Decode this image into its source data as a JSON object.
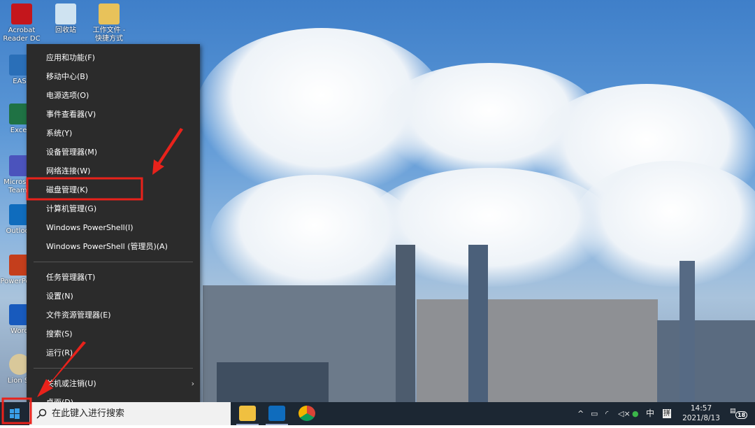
{
  "desktop": {
    "icons": [
      {
        "label": "Acrobat Reader DC",
        "color": "#c4161c"
      },
      {
        "label": "回收站",
        "color": "#cfe3f1"
      },
      {
        "label": "工作文件 - 快捷方式",
        "color": "#e8c25a"
      },
      {
        "label": "EAS",
        "color": "#2a6fb8"
      },
      {
        "label": "Excel",
        "color": "#1f7244"
      },
      {
        "label": "Microsoft Teams",
        "color": "#4b53bc"
      },
      {
        "label": "Outlook",
        "color": "#0f6cbd"
      },
      {
        "label": "PowerPoint",
        "color": "#c43e1c"
      },
      {
        "label": "Word",
        "color": "#185abd"
      },
      {
        "label": "Lion St",
        "color": "#d9c89a"
      }
    ]
  },
  "context_menu": {
    "groups": [
      [
        "应用和功能(F)",
        "移动中心(B)",
        "电源选项(O)",
        "事件查看器(V)",
        "系统(Y)",
        "设备管理器(M)",
        "网络连接(W)",
        "磁盘管理(K)",
        "计算机管理(G)",
        "Windows PowerShell(I)",
        "Windows PowerShell (管理员)(A)"
      ],
      [
        "任务管理器(T)",
        "设置(N)",
        "文件资源管理器(E)",
        "搜索(S)",
        "运行(R)"
      ],
      [
        "关机或注销(U)",
        "桌面(D)"
      ]
    ],
    "highlighted_item": "磁盘管理(K)",
    "annotation_color": "#e8221b"
  },
  "taskbar": {
    "search_placeholder": "在此键入进行搜索",
    "pinned": [
      "file-explorer-icon",
      "outlook-icon",
      "chrome-icon"
    ],
    "tray": {
      "ime": "中",
      "ime_mode": "拼",
      "time": "14:57",
      "date": "2021/8/13",
      "notifications": "18"
    }
  }
}
